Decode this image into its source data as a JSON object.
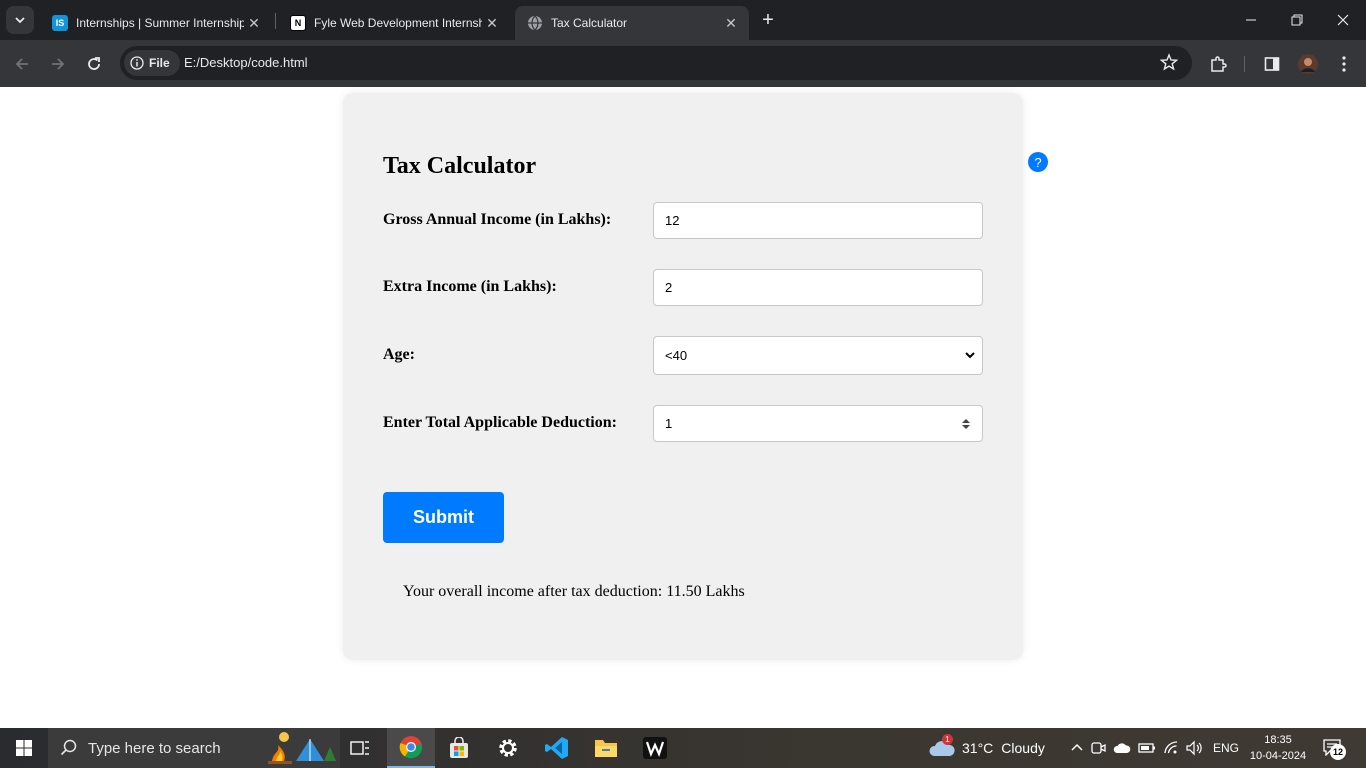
{
  "browser": {
    "tabs": [
      {
        "favicon": "IS",
        "title": "Internships | Summer Internship",
        "active": false
      },
      {
        "favicon": "N",
        "title": "Fyle Web Development Internshi",
        "active": false
      },
      {
        "favicon": "globe",
        "title": "Tax Calculator",
        "active": true
      }
    ],
    "omnibox": {
      "chip_label": "File",
      "url": "E:/Desktop/code.html"
    }
  },
  "page": {
    "title": "Tax Calculator",
    "fields": [
      {
        "label": "Gross Annual Income (in Lakhs):",
        "value": "12"
      },
      {
        "label": "Extra Income (in Lakhs):",
        "value": "2"
      },
      {
        "label": "Age:",
        "value": "<40"
      },
      {
        "label": "Enter Total Applicable Deduction:",
        "value": "1"
      }
    ],
    "submit_label": "Submit",
    "result_text": "Your overall income after tax deduction: 11.50 Lakhs",
    "help_label": "?"
  },
  "taskbar": {
    "search_placeholder": "Type here to search",
    "weather": {
      "temp": "31°C",
      "condition": "Cloudy",
      "badge": "1"
    },
    "language": "ENG",
    "time": "18:35",
    "date": "10-04-2024",
    "notification_count": "12"
  },
  "colors": {
    "accent": "#007bff",
    "card_bg": "#f0f0f0",
    "chrome_dark": "#202124",
    "chrome_toolbar": "#35363a"
  }
}
